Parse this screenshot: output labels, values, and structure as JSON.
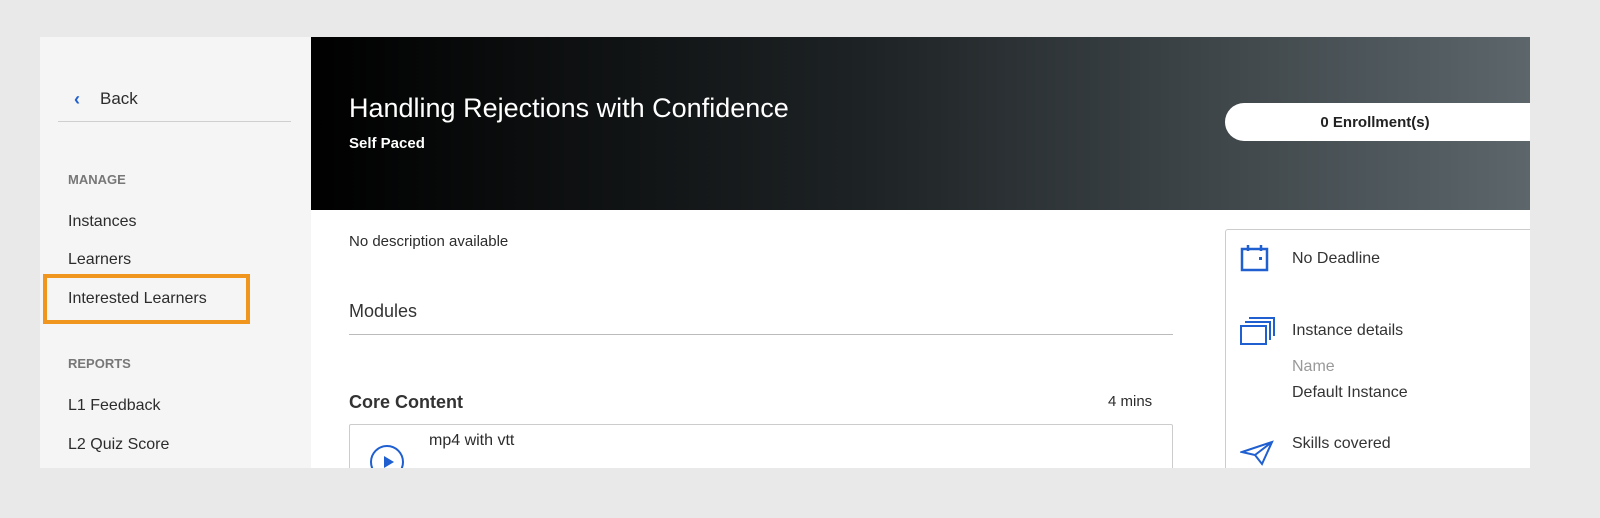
{
  "sidebar": {
    "back": "Back",
    "manage_heading": "MANAGE",
    "manage_items": [
      "Instances",
      "Learners",
      "Interested Learners"
    ],
    "reports_heading": "REPORTS",
    "report_items": [
      "L1 Feedback",
      "L2 Quiz Score"
    ]
  },
  "header": {
    "title": "Handling Rejections with Confidence",
    "subtitle": "Self Paced",
    "enrollments": "0 Enrollment(s)"
  },
  "main": {
    "description": "No description available",
    "modules_heading": "Modules",
    "section_title": "Core Content",
    "section_duration": "4 mins",
    "modules": [
      {
        "name": "mp4 with vtt",
        "icon": "play-icon"
      }
    ]
  },
  "panel": {
    "deadline": "No Deadline",
    "instance_heading": "Instance details",
    "name_label": "Name",
    "name_value": "Default Instance",
    "skills_heading": "Skills covered"
  },
  "colors": {
    "accent": "#1f5fd0",
    "highlight": "#f0961e"
  }
}
